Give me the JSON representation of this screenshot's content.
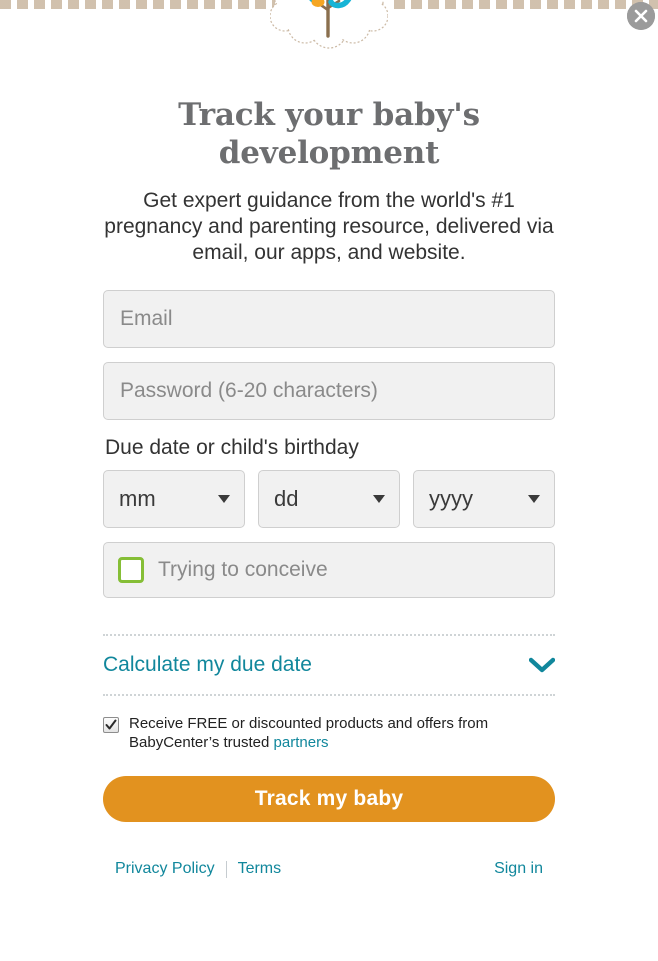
{
  "modal": {
    "close_label": "close-dialog",
    "logo_name": "babycenter-tree-logo"
  },
  "headline": "Track your baby's development",
  "subhead": "Get expert guidance from the world's #1 pregnancy and parenting resource, delivered via email, our apps, and website.",
  "form": {
    "email": {
      "value": "",
      "placeholder": "Email"
    },
    "password": {
      "value": "",
      "placeholder": "Password (6-20 characters)"
    },
    "date_label": "Due date or child's birthday",
    "month": {
      "selected": "mm"
    },
    "day": {
      "selected": "dd"
    },
    "year": {
      "selected": "yyyy"
    },
    "trying_to_conceive": {
      "label": "Trying to conceive",
      "checked": false
    }
  },
  "calculate": {
    "label": "Calculate my due date",
    "expanded": false
  },
  "offers": {
    "checked": true,
    "text_before": "Receive FREE or discounted products and offers from BabyCenter’s trusted ",
    "link_text": "partners"
  },
  "cta": {
    "label": "Track my baby"
  },
  "footer": {
    "privacy": "Privacy Policy",
    "terms": "Terms",
    "signin": "Sign in"
  },
  "colors": {
    "accent_teal": "#11879c",
    "cta_orange": "#e2921f",
    "check_green": "#85be36",
    "headline_gray": "#6d6e70",
    "border_tan": "#c9b69f"
  }
}
